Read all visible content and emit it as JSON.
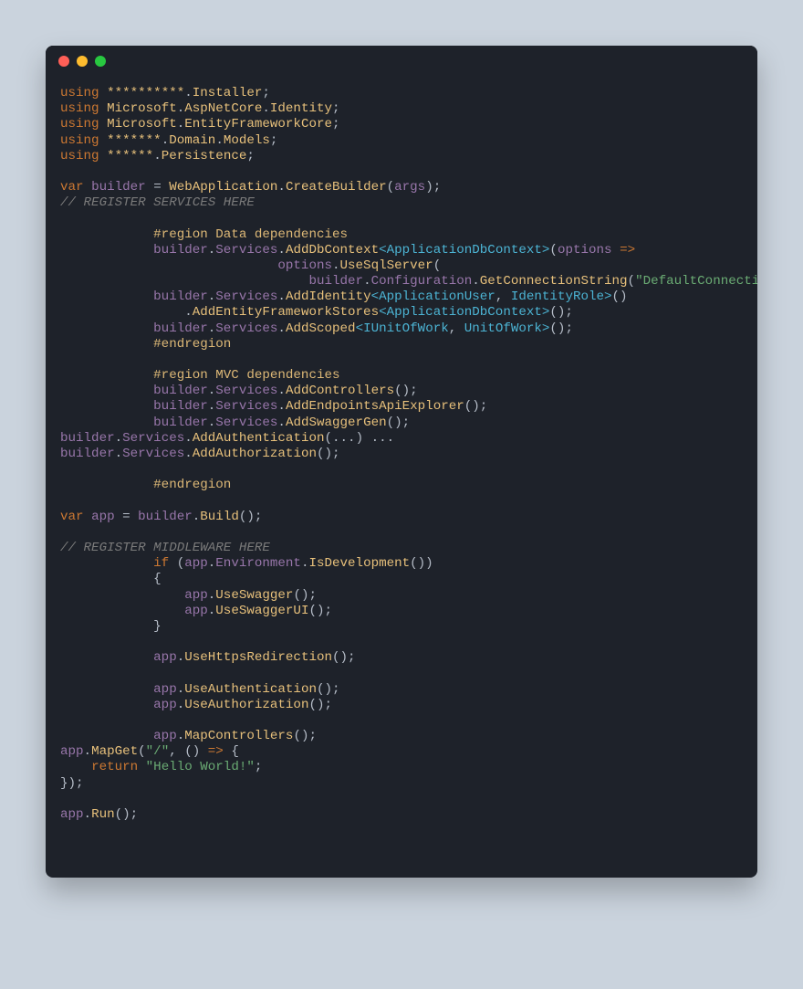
{
  "titlebar": {
    "buttons": {
      "close": "close-icon",
      "minimize": "minimize-icon",
      "zoom": "zoom-icon"
    }
  },
  "l": {
    "using": "using",
    "var": "var",
    "if": "if",
    "return": "return",
    "masked10": "**********",
    "masked7": "*******",
    "masked6": "******",
    "Installer": "Installer",
    "Microsoft": "Microsoft",
    "AspNetCore": "AspNetCore",
    "Identity": "Identity",
    "EntityFrameworkCore": "EntityFrameworkCore",
    "Domain": "Domain",
    "Models": "Models",
    "Persistence": "Persistence",
    "builder": "builder",
    "WebApplication": "WebApplication",
    "CreateBuilder": "CreateBuilder",
    "args": "args",
    "reg_services": "// REGISTER SERVICES HERE",
    "region_data": "#region Data dependencies",
    "endregion": "#endregion",
    "region_mvc": "#region MVC dependencies",
    "Services": "Services",
    "AddDbContext": "AddDbContext",
    "ApplicationDbContext": "ApplicationDbContext",
    "options": "options",
    "arrow": "=>",
    "UseSqlServer": "UseSqlServer",
    "Configuration": "Configuration",
    "GetConnectionString": "GetConnectionString",
    "DefaultConnection": "\"DefaultConnection\"",
    "AddIdentity": "AddIdentity",
    "ApplicationUser": "ApplicationUser",
    "IdentityRole": "IdentityRole",
    "AddEntityFrameworkStores": "AddEntityFrameworkStores",
    "AddScoped": "AddScoped",
    "IUnitOfWork": "IUnitOfWork",
    "UnitOfWork": "UnitOfWork",
    "AddControllers": "AddControllers",
    "AddEndpointsApiExplorer": "AddEndpointsApiExplorer",
    "AddSwaggerGen": "AddSwaggerGen",
    "AddAuthentication": "AddAuthentication",
    "AddAuthorization": "AddAuthorization",
    "app": "app",
    "Build": "Build",
    "reg_mw": "// REGISTER MIDDLEWARE HERE",
    "Environment": "Environment",
    "IsDevelopment": "IsDevelopment",
    "UseSwagger": "UseSwagger",
    "UseSwaggerUI": "UseSwaggerUI",
    "UseHttpsRedirection": "UseHttpsRedirection",
    "UseAuthentication": "UseAuthentication",
    "UseAuthorization": "UseAuthorization",
    "MapControllers": "MapControllers",
    "MapGet": "MapGet",
    "root": "\"/\"",
    "hello": "\"Hello World!\"",
    "Run": "Run",
    "ellipsis": "...",
    "brace_open": "{",
    "brace_close": "}"
  }
}
